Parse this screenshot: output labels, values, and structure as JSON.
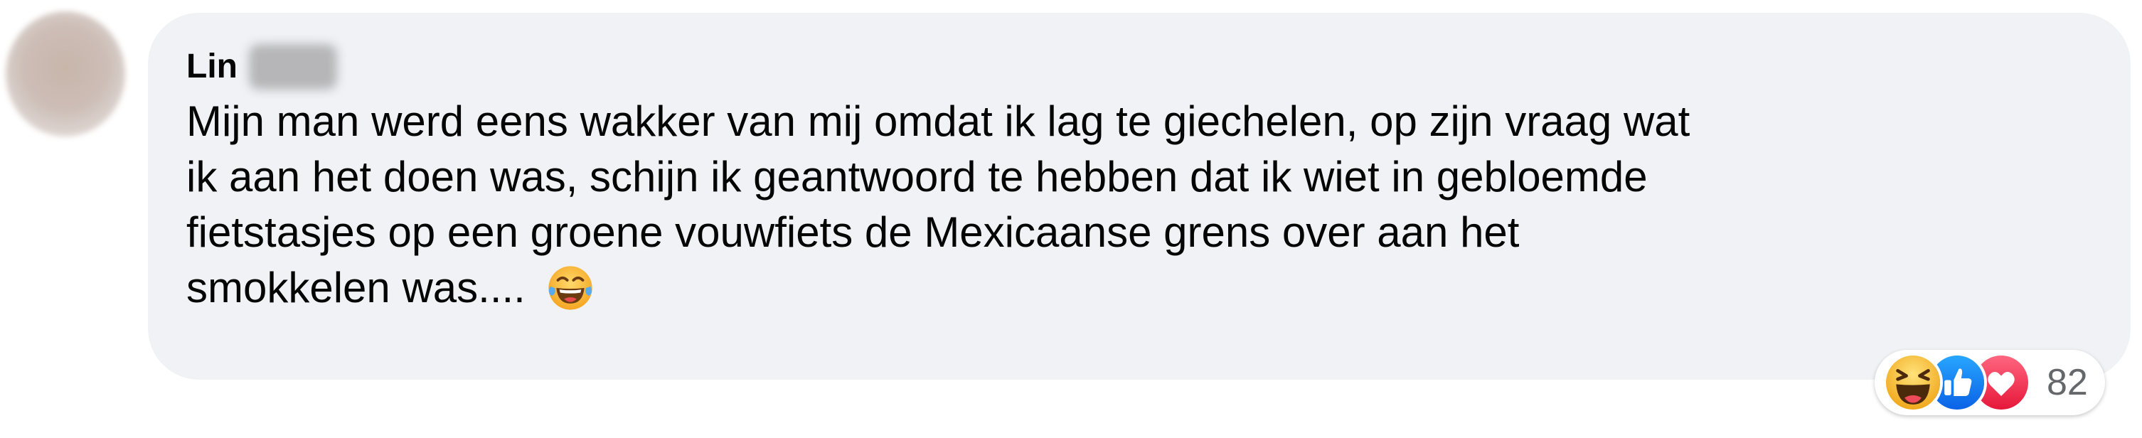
{
  "comment": {
    "author": "Lin",
    "text_lines": [
      "Mijn man werd eens wakker van mij omdat ik lag te giechelen, op zijn vraag wat",
      "ik aan het doen was, schijn ik geantwoord te hebben dat ik wiet in gebloemde",
      "fietstasjes op een groene vouwfiets de Mexicaanse grens over aan het",
      "smokkelen was...."
    ],
    "inline_emoji": "laughing-tears-emoji"
  },
  "reactions": {
    "icons": [
      "haha-reaction-icon",
      "like-reaction-icon",
      "love-reaction-icon"
    ],
    "count": "82"
  },
  "colors": {
    "bubble_bg": "#f0f2f5",
    "text": "#050505",
    "count_text": "#65676b",
    "like_blue": "#1877f2",
    "love_red": "#f33e58",
    "haha_yellow": "#f7b125"
  }
}
